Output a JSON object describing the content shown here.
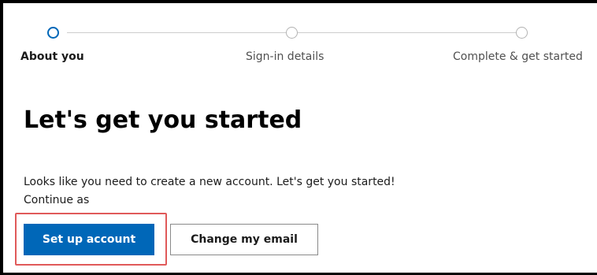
{
  "stepper": {
    "steps": [
      {
        "label": "About you",
        "state": "active"
      },
      {
        "label": "Sign-in details",
        "state": "inactive"
      },
      {
        "label": "Complete & get started",
        "state": "inactive"
      }
    ]
  },
  "main": {
    "heading": "Let's get you started",
    "message": "Looks like you need to create a new account. Let's get you started!",
    "continue_as": "Continue as"
  },
  "actions": {
    "primary_label": "Set up account",
    "secondary_label": "Change my email"
  },
  "colors": {
    "accent": "#0067b8",
    "highlight": "#e05a5a",
    "inactive_step": "#b3b3b3"
  }
}
